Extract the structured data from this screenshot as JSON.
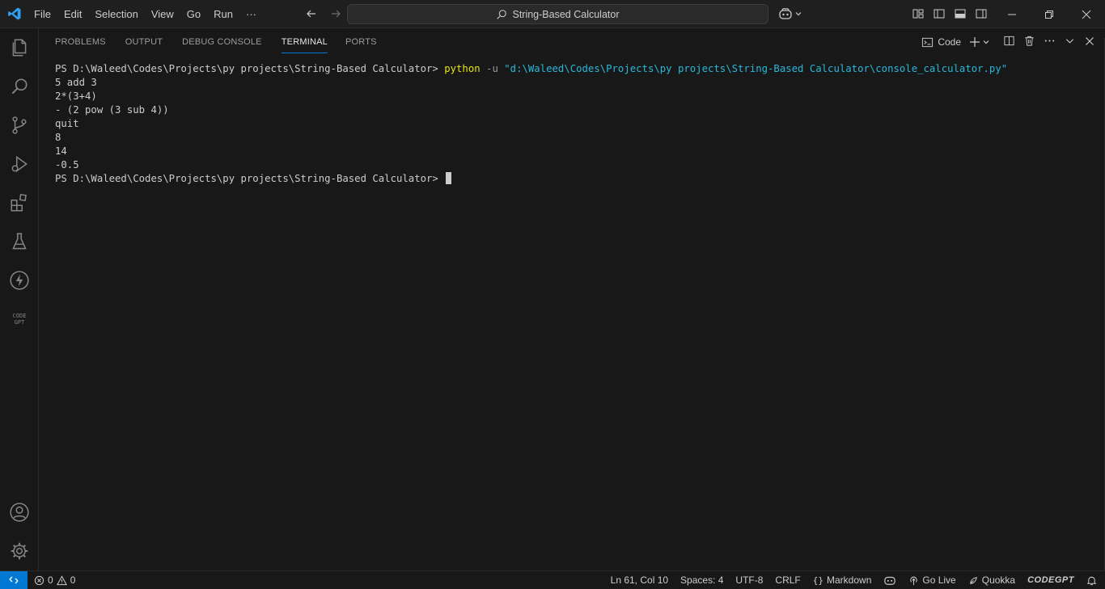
{
  "titlebar": {
    "menu": [
      "File",
      "Edit",
      "Selection",
      "View",
      "Go",
      "Run",
      "···"
    ],
    "search_text": "String-Based Calculator"
  },
  "panel": {
    "tabs": [
      "PROBLEMS",
      "OUTPUT",
      "DEBUG CONSOLE",
      "TERMINAL",
      "PORTS"
    ],
    "active_tab": "TERMINAL",
    "terminal_profile": "Code"
  },
  "terminal": {
    "prompt": "PS D:\\Waleed\\Codes\\Projects\\py projects\\String-Based Calculator> ",
    "command": "python",
    "flag": " -u ",
    "arg": "\"d:\\Waleed\\Codes\\Projects\\py projects\\String-Based Calculator\\console_calculator.py\"",
    "output": [
      "5 add 3",
      "2*(3+4)",
      "- (2 pow (3 sub 4))",
      "quit",
      "8",
      "14",
      "-0.5"
    ],
    "final_prompt": "PS D:\\Waleed\\Codes\\Projects\\py projects\\String-Based Calculator> "
  },
  "statusbar": {
    "errors": "0",
    "warnings": "0",
    "position": "Ln 61, Col 10",
    "spaces": "Spaces: 4",
    "encoding": "UTF-8",
    "eol": "CRLF",
    "language": "Markdown",
    "go_live": "Go Live",
    "quokka": "Quokka",
    "codegpt": "CODEGPT"
  },
  "colors": {
    "accent": "#0078d4",
    "python_cmd": "#e5e510",
    "string_arg": "#29b8db"
  }
}
